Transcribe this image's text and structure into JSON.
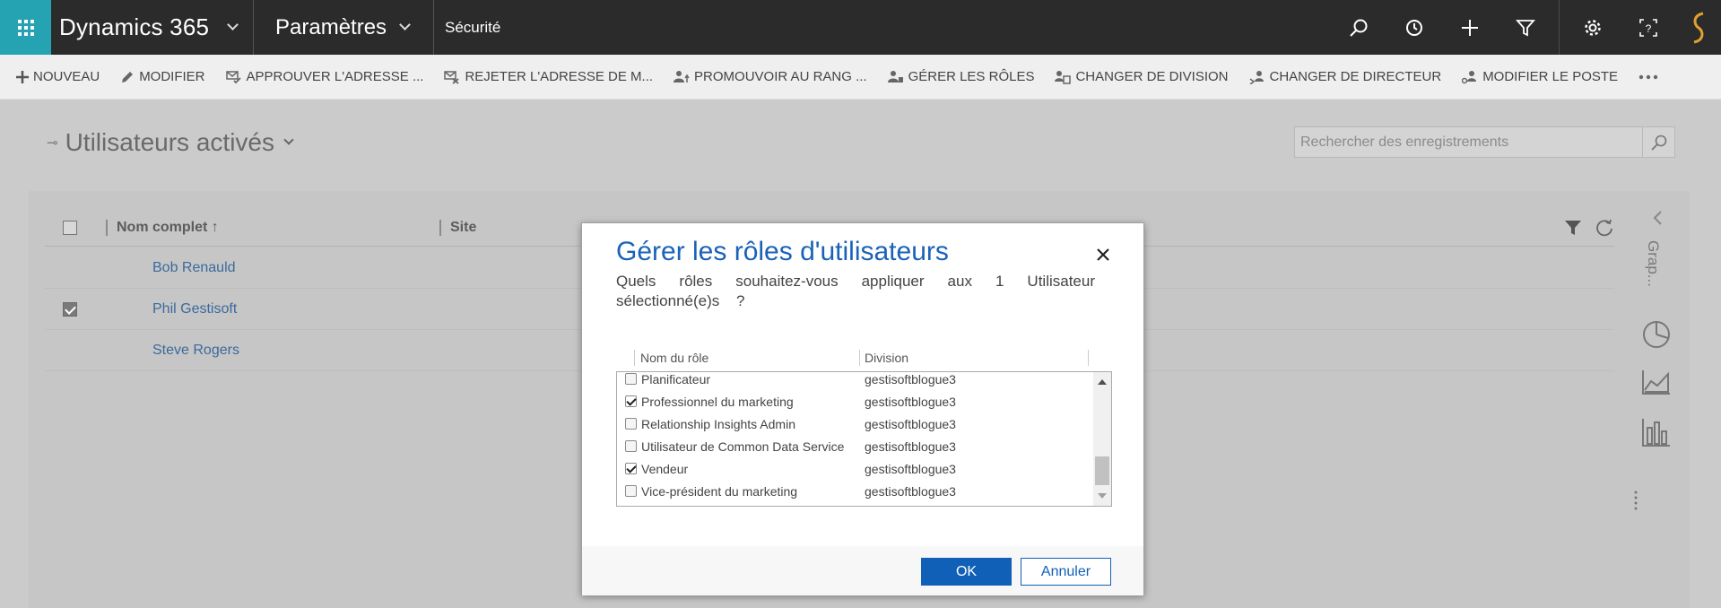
{
  "topbar": {
    "app_name": "Dynamics 365",
    "area": "Paramètres",
    "breadcrumb": "Sécurité"
  },
  "commands": [
    {
      "label": "NOUVEAU",
      "icon": "plus-icon"
    },
    {
      "label": "MODIFIER",
      "icon": "pencil-icon"
    },
    {
      "label": "APPROUVER L'ADRESSE ...",
      "icon": "approve-mail-icon"
    },
    {
      "label": "REJETER L'ADRESSE DE M...",
      "icon": "reject-mail-icon"
    },
    {
      "label": "PROMOUVOIR AU RANG ...",
      "icon": "promote-user-icon"
    },
    {
      "label": "GÉRER LES RÔLES",
      "icon": "manage-roles-icon"
    },
    {
      "label": "CHANGER DE DIVISION",
      "icon": "change-division-icon"
    },
    {
      "label": "CHANGER DE DIRECTEUR",
      "icon": "change-manager-icon"
    },
    {
      "label": "MODIFIER LE POSTE",
      "icon": "change-position-icon"
    }
  ],
  "view": {
    "title": "Utilisateurs activés",
    "search_placeholder": "Rechercher des enregistrements",
    "columns": [
      "Nom complet ↑",
      "Site"
    ],
    "rows": [
      {
        "name": "Bob Renauld",
        "checked": false
      },
      {
        "name": "Phil Gestisoft",
        "checked": true
      },
      {
        "name": "Steve Rogers",
        "checked": false
      }
    ],
    "side_label": "Grap..."
  },
  "dialog": {
    "title": "Gérer les rôles d'utilisateurs",
    "description": "Quels rôles souhaitez-vous appliquer aux 1 Utilisateur sélectionné(e)s ?",
    "col_role": "Nom du rôle",
    "col_division": "Division",
    "roles": [
      {
        "name": "Planificateur",
        "division": "gestisoftblogue3",
        "checked": false
      },
      {
        "name": "Professionnel du marketing",
        "division": "gestisoftblogue3",
        "checked": true
      },
      {
        "name": "Relationship Insights Admin",
        "division": "gestisoftblogue3",
        "checked": false
      },
      {
        "name": "Utilisateur de Common Data Service",
        "division": "gestisoftblogue3",
        "checked": false
      },
      {
        "name": "Vendeur",
        "division": "gestisoftblogue3",
        "checked": true
      },
      {
        "name": "Vice-président du marketing",
        "division": "gestisoftblogue3",
        "checked": false
      }
    ],
    "ok_label": "OK",
    "cancel_label": "Annuler"
  },
  "colors": {
    "waffle": "#25a3b2",
    "topbar": "#2b2b2b",
    "accent": "#1160b7",
    "link": "#3b6a9c"
  }
}
